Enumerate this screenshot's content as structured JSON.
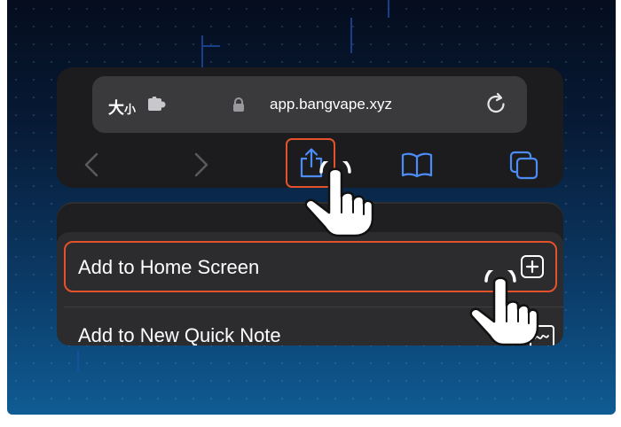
{
  "browser": {
    "text_size_label": "大",
    "text_size_label_small": "小",
    "url": "app.bangvape.xyz"
  },
  "toolbar": {
    "back": "back",
    "forward": "forward",
    "share": "share",
    "bookmarks": "bookmarks",
    "tabs": "tabs"
  },
  "share_sheet": {
    "items": [
      {
        "label": "Add to Home Screen",
        "icon": "add-square-icon",
        "highlighted": true
      },
      {
        "label": "Add to New Quick Note",
        "icon": "quick-note-icon",
        "highlighted": false
      }
    ]
  },
  "colors": {
    "highlight": "#e3522b",
    "accent": "#4c8cf7",
    "panel": "#1c1c1e",
    "sheet": "#2c2c2e"
  }
}
